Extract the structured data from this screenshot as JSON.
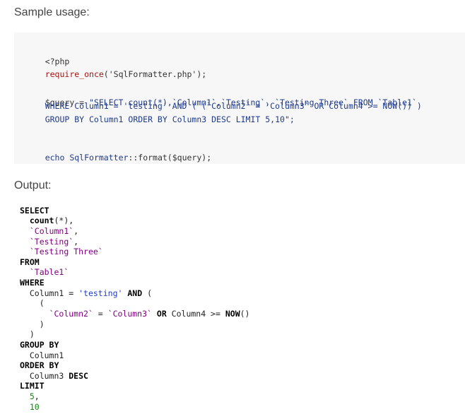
{
  "sample_heading": "Sample usage:",
  "output_heading": "Output:",
  "code": {
    "l1": "<?php",
    "l2_fn": "require_once",
    "l2_rest": "('SqlFormatter.php');",
    "l3_var": "$query = ",
    "l3_str": "\"SELECT count(*),`Column1`,`Testing`, `Testing Three` FROM `Table1`",
    "l4": "    WHERE Column1 = 'testing' AND ( (`Column2` = `Column3` OR Column4 >= NOW()) )",
    "l5": "    GROUP BY Column1 ORDER BY Column3 DESC LIMIT 5,10\";",
    "l6_echo": "echo ",
    "l6_cls": "SqlFormatter",
    "l6_rest": "::format($query);"
  },
  "output": {
    "select": "SELECT",
    "count": "count",
    "count_rest": "(*),",
    "col1": "`Column1`",
    "comma": ",",
    "testing": "`Testing`",
    "testing_three": "`Testing Three`",
    "from": "FROM",
    "table1": "`Table1`",
    "where": "WHERE",
    "col1_plain": "Column1 = ",
    "testing_str": "'testing'",
    "and": "AND",
    "paren_open": "(",
    "col2": "`Column2`",
    "eq": " = ",
    "col3": "`Column3`",
    "or": "OR",
    "col4": " Column4 >= ",
    "now": "NOW",
    "now_parens": "()",
    "paren_close": ")",
    "group_by": "GROUP BY",
    "column1": "Column1",
    "order_by": "ORDER BY",
    "column3": "Column3 ",
    "desc": "DESC",
    "limit": "LIMIT",
    "five": "5",
    "ten": "10"
  }
}
